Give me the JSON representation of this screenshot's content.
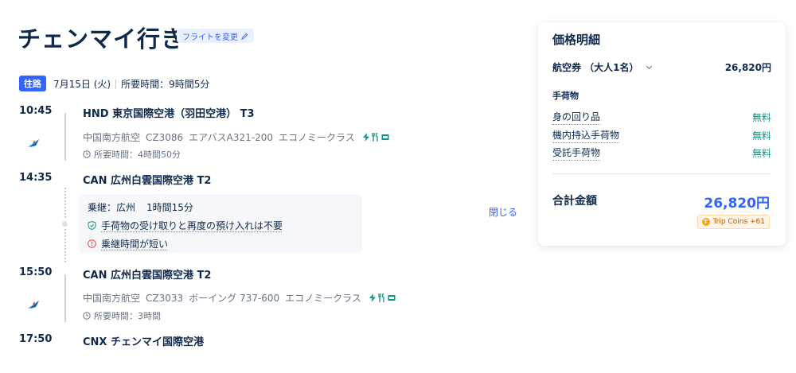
{
  "page": {
    "title": "チェンマイ行き",
    "change_flight": "フライトを変更"
  },
  "route": {
    "badge": "往路",
    "date": "7月15日 (火)",
    "total_duration": "所要時間：9時間5分"
  },
  "segments": [
    {
      "dep_time": "10:45",
      "dep_airport": "HND 東京国際空港（羽田空港） T3",
      "airline": "中国南方航空",
      "flight_no": "CZ3086",
      "aircraft": "エアバスA321-200",
      "cabin": "エコノミークラス",
      "duration": "所要時間：4時間50分",
      "arr_time": "14:35",
      "arr_airport": "CAN 広州白雲国際空港 T2"
    },
    {
      "dep_time": "15:50",
      "dep_airport": "CAN 広州白雲国際空港 T2",
      "airline": "中国南方航空",
      "flight_no": "CZ3033",
      "aircraft": "ボーイング 737-600",
      "cabin": "エコノミークラス",
      "duration": "所要時間：3時間",
      "arr_time": "17:50",
      "arr_airport": "CNX チェンマイ国際空港"
    }
  ],
  "transfer": {
    "city": "乗継：広州",
    "time": "1時間15分",
    "baggage_note": "手荷物の受け取りと再度の預け入れは不要",
    "warning": "乗継時間が短い",
    "close": "閉じる"
  },
  "price": {
    "title": "価格明細",
    "ticket_label": "航空券 （大人1名）",
    "ticket_value": "26,820円",
    "baggage_title": "手荷物",
    "baggage_items": [
      {
        "label": "身の回り品",
        "value": "無料"
      },
      {
        "label": "機内持込手荷物",
        "value": "無料"
      },
      {
        "label": "受託手荷物",
        "value": "無料"
      }
    ],
    "total_label": "合計金額",
    "total_value": "26,820円",
    "coins": "Trip Coins +61"
  },
  "colors": {
    "accent": "#3264ff",
    "text": "#0f294d",
    "secondary": "#6b7585",
    "free": "#0f9683",
    "amenity": "#0f9683"
  }
}
